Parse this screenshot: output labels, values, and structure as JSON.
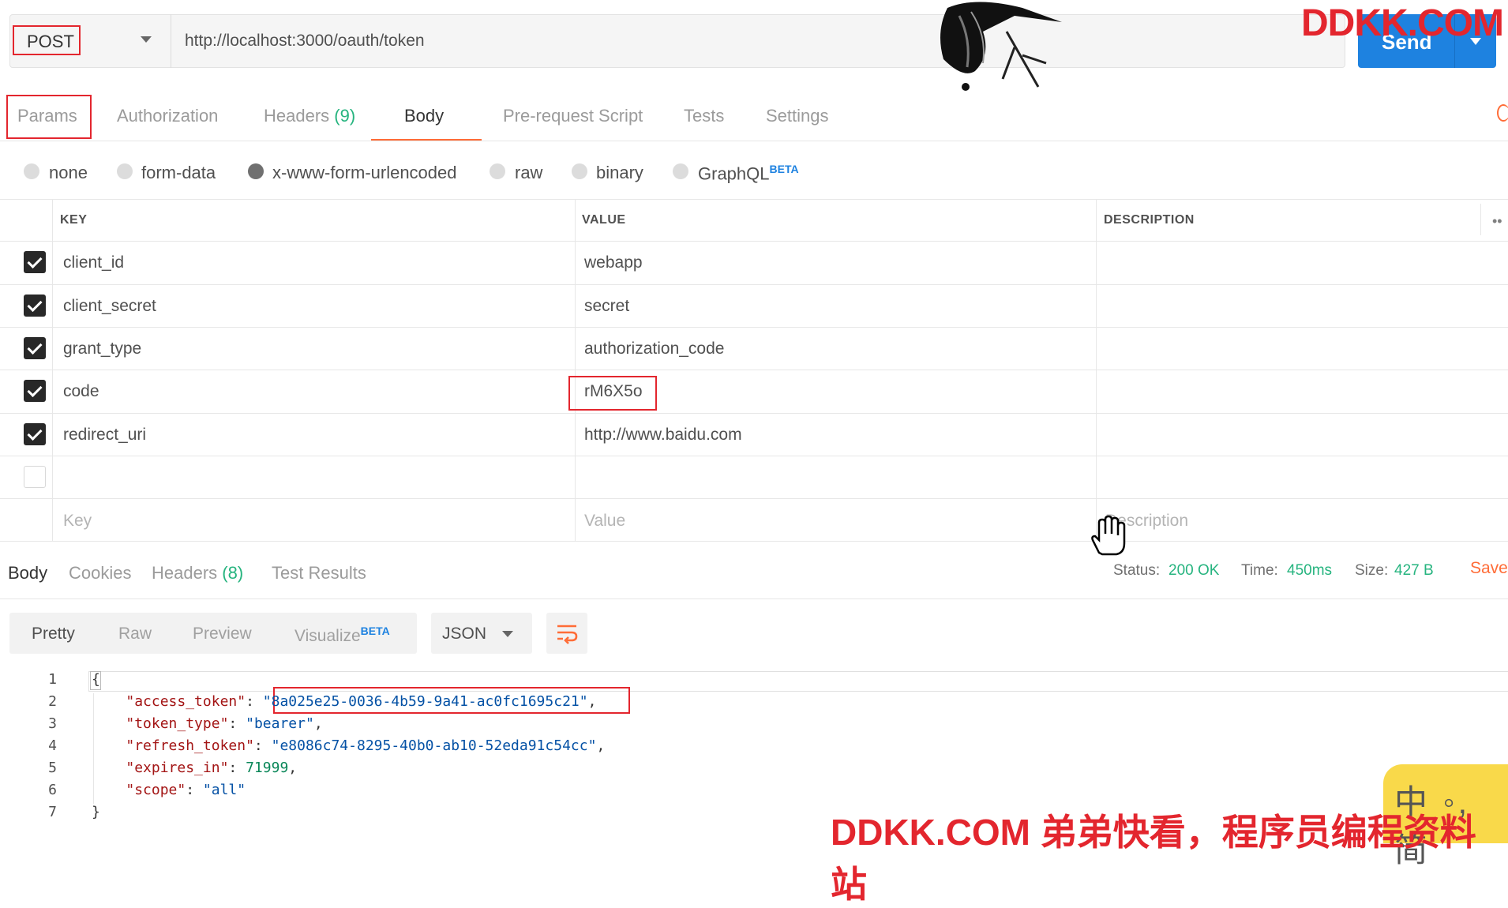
{
  "request": {
    "method": "POST",
    "url": "http://localhost:3000/oauth/token",
    "send_label": "Send"
  },
  "watermark": {
    "top": "DDKK.COM",
    "bottom": "DDKK.COM 弟弟快看，程序员编程资料站",
    "ime": "中 ◦, 简"
  },
  "tabs": {
    "params": "Params",
    "authorization": "Authorization",
    "headers": "Headers",
    "headers_count": "(9)",
    "body": "Body",
    "prerequest": "Pre-request Script",
    "tests": "Tests",
    "settings": "Settings"
  },
  "body_types": {
    "none": "none",
    "form_data": "form-data",
    "urlencoded": "x-www-form-urlencoded",
    "raw": "raw",
    "binary": "binary",
    "graphql": "GraphQL",
    "beta": "BETA"
  },
  "table": {
    "headers": {
      "key": "KEY",
      "value": "VALUE",
      "description": "DESCRIPTION",
      "more": "••"
    },
    "rows": [
      {
        "key": "client_id",
        "value": "webapp"
      },
      {
        "key": "client_secret",
        "value": "secret"
      },
      {
        "key": "grant_type",
        "value": "authorization_code"
      },
      {
        "key": "code",
        "value": "rM6X5o"
      },
      {
        "key": "redirect_uri",
        "value": "http://www.baidu.com"
      }
    ],
    "placeholders": {
      "key": "Key",
      "value": "Value",
      "description": "Description"
    }
  },
  "response": {
    "tabs": {
      "body": "Body",
      "cookies": "Cookies",
      "headers": "Headers",
      "headers_count": "(8)",
      "test_results": "Test Results"
    },
    "status_label": "Status:",
    "status_value": "200 OK",
    "time_label": "Time:",
    "time_value": "450ms",
    "size_label": "Size:",
    "size_value": "427 B",
    "save": "Save",
    "formats": {
      "pretty": "Pretty",
      "raw": "Raw",
      "preview": "Preview",
      "visualize": "Visualize",
      "beta": "BETA"
    },
    "language": "JSON",
    "json": {
      "access_token": "8a025e25-0036-4b59-9a41-ac0fc1695c21",
      "token_type": "bearer",
      "refresh_token": "e8086c74-8295-40b0-ab10-52eda91c54cc",
      "expires_in": "71999",
      "scope": "all"
    },
    "line_numbers": [
      "1",
      "2",
      "3",
      "4",
      "5",
      "6",
      "7"
    ]
  }
}
